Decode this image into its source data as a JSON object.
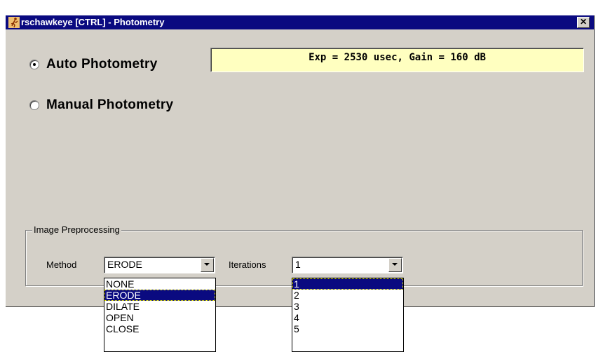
{
  "window": {
    "title": "rschawkeye [CTRL] - Photometry",
    "close_label": "✕",
    "titlebar_color": "#0a0a80",
    "icon": "running-figure-icon"
  },
  "photometry": {
    "auto_label": "Auto Photometry",
    "manual_label": "Manual Photometry",
    "selected": "auto",
    "status_text": "Exp = 2530 usec, Gain = 160 dB",
    "status_bg": "#ffffc0"
  },
  "preprocessing": {
    "group_label": "Image Preprocessing",
    "method_label": "Method",
    "method_value": "ERODE",
    "method_options": [
      "NONE",
      "ERODE",
      "DILATE",
      "OPEN",
      "CLOSE"
    ],
    "method_selected": "ERODE",
    "iterations_label": "Iterations",
    "iterations_value": "1",
    "iterations_options": [
      "1",
      "2",
      "3",
      "4",
      "5"
    ],
    "iterations_selected": "1"
  }
}
